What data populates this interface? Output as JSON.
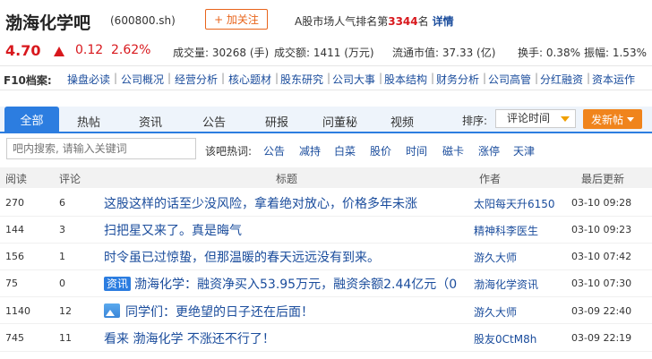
{
  "header": {
    "title": "渤海化学吧",
    "code": "(600800.sh)",
    "follow_label": "+ 加关注",
    "rank_prefix": "A股市场人气排名第",
    "rank_value": "3344",
    "rank_suffix": "名",
    "detail_link": "详情"
  },
  "quote": {
    "price": "4.70",
    "change": "0.12",
    "change_pct": "2.62%",
    "stats": [
      "成交量: 30268 (手)",
      "成交额: 1411 (万元)",
      "流通市值: 37.33 (亿)",
      "换手: 0.38%",
      "振幅: 1.53%"
    ]
  },
  "f10": {
    "label": "F10档案:",
    "links": [
      "操盘必读",
      "公司概况",
      "经营分析",
      "核心题材",
      "股东研究",
      "公司大事",
      "股本结构",
      "财务分析",
      "公司高管",
      "分红融资",
      "资本运作"
    ]
  },
  "tabs": [
    "全部",
    "热帖",
    "资讯",
    "公告",
    "研报",
    "问董秘",
    "视频"
  ],
  "sort": {
    "label": "排序:",
    "selected": "评论时间",
    "new_post": "发新帖"
  },
  "search": {
    "placeholder": "吧内搜索, 请输入关键词"
  },
  "hot": {
    "label": "该吧热词:",
    "words": [
      "公告",
      "减持",
      "白菜",
      "股价",
      "时间",
      "磁卡",
      "涨停",
      "天津"
    ]
  },
  "table": {
    "headers": [
      "阅读",
      "评论",
      "标题",
      "作者",
      "最后更新"
    ],
    "rows": [
      {
        "read": "270",
        "comments": "6",
        "title": "这股这样的话至少没风险，拿着绝对放心，价格多年未涨",
        "author": "太阳每天升6150",
        "time": "03-10 09:28"
      },
      {
        "read": "144",
        "comments": "3",
        "title": "扫把星又来了。真是晦气",
        "author": "精神科李医生",
        "time": "03-10 09:23"
      },
      {
        "read": "156",
        "comments": "1",
        "title": "时令虽已过惊蛰，但那温暖的春天远远没有到来。",
        "author": "游久大师",
        "time": "03-10 07:42"
      },
      {
        "read": "75",
        "comments": "0",
        "badge": "资讯",
        "title": "渤海化学：融资净买入53.95万元，融资余额2.44亿元（0",
        "author": "渤海化学资讯",
        "time": "03-10 07:30"
      },
      {
        "read": "1140",
        "comments": "12",
        "title": "同学们：更绝望的日子还在后面！",
        "author": "游久大师",
        "time": "03-09 22:40"
      },
      {
        "read": "745",
        "comments": "11",
        "title": "看来 渤海化学 不涨还不行了！",
        "author": "股友0CtM8h",
        "time": "03-09 22:19"
      }
    ]
  },
  "colors": {
    "accent": "#2c7de0",
    "up": "#d8181d",
    "orange": "#f0841c",
    "link": "#1a4c9c"
  }
}
